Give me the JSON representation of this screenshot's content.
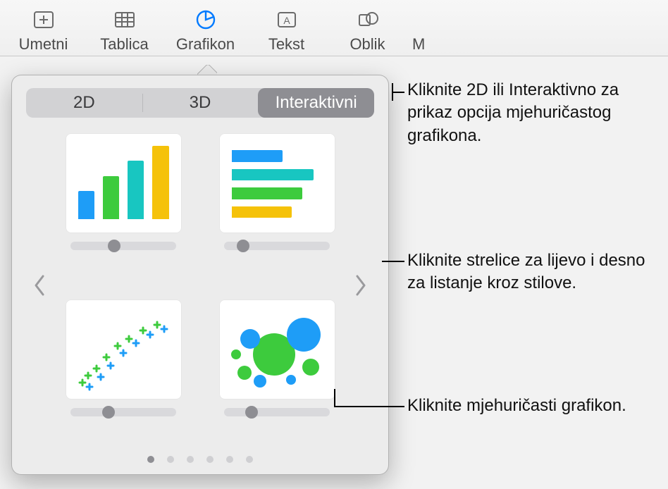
{
  "toolbar": {
    "items": [
      {
        "label": "Umetni"
      },
      {
        "label": "Tablica"
      },
      {
        "label": "Grafikon"
      },
      {
        "label": "Tekst"
      },
      {
        "label": "Oblik"
      },
      {
        "label": "M"
      }
    ]
  },
  "popover": {
    "tabs": {
      "twoD": "2D",
      "threeD": "3D",
      "interactive": "Interaktivni"
    },
    "slider_positions": [
      0.35,
      0.12,
      0.3,
      0.2
    ],
    "page_count": 6,
    "active_page": 0
  },
  "callouts": {
    "tabs": "Kliknite 2D ili Interaktivno za prikaz opcija mjehuričastog grafikona.",
    "arrows": "Kliknite strelice za lijevo i desno za listanje kroz stilove.",
    "bubble": "Kliknite mjehuričasti grafikon."
  }
}
